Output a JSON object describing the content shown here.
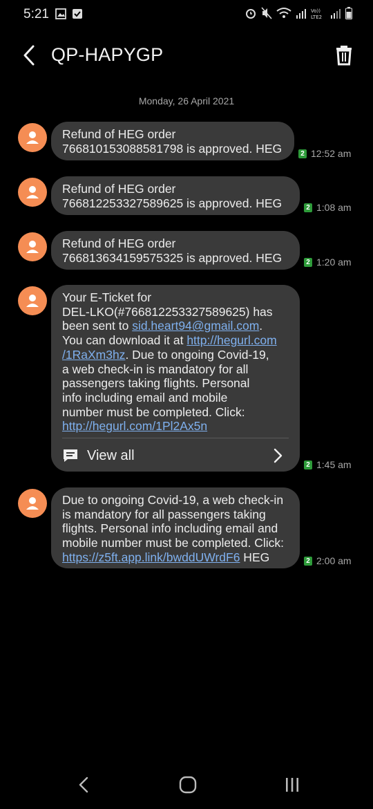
{
  "status_bar": {
    "time": "5:21"
  },
  "header": {
    "title": "QP-HAPYGP"
  },
  "date_separator": "Monday, 26 April 2021",
  "messages": [
    {
      "lines": [
        "Refund of HEG order",
        "766810153088581798 is approved. HEG"
      ],
      "sim": "2",
      "time": "12:52 am"
    },
    {
      "lines": [
        "Refund of HEG order",
        "766812253327589625 is approved. HEG"
      ],
      "sim": "2",
      "time": "1:08 am"
    },
    {
      "lines": [
        "Refund of HEG order",
        "766813634159575325 is approved. HEG"
      ],
      "sim": "2",
      "time": "1:20 am"
    },
    {
      "parts": {
        "p1": "Your E-Ticket for",
        "p2": "DEL-LKO(#766812253327589625) has",
        "p3": "been sent to ",
        "email": "sid.heart94@gmail.com",
        "p3b": ".",
        "p4": "You can download it at ",
        "link1a": "http://hegurl.com",
        "link1b": "/1RaXm3hz",
        "p5": ". Due to ongoing Covid-19,",
        "p6": "a web check-in is mandatory for all",
        "p7": "passengers taking flights. Personal",
        "p8": "info including email and mobile",
        "p9": "number must be completed. Click:",
        "link2": "http://hegurl.com/1Pl2Ax5n"
      },
      "view_all_label": "View all",
      "sim": "2",
      "time": "1:45 am"
    },
    {
      "parts": {
        "l1": "Due to ongoing Covid-19, a web check-in",
        "l2": "is mandatory for all passengers taking",
        "l3": "flights. Personal info including email and",
        "l4": "mobile number must be completed. Click:",
        "link": "https://z5ft.app.link/bwddUWrdF6",
        "tail": " HEG"
      },
      "sim": "2",
      "time": "2:00 am"
    }
  ],
  "icons": {
    "back": "back-arrow-icon",
    "delete": "trash-icon",
    "avatar": "person-icon",
    "view_all": "message-icon",
    "chevron": "chevron-right-icon"
  },
  "colors": {
    "background": "#000000",
    "bubble": "#3a3a3a",
    "avatar": "#f58d54",
    "link": "#7fb0ee",
    "sim_badge": "#2e9b3a"
  }
}
